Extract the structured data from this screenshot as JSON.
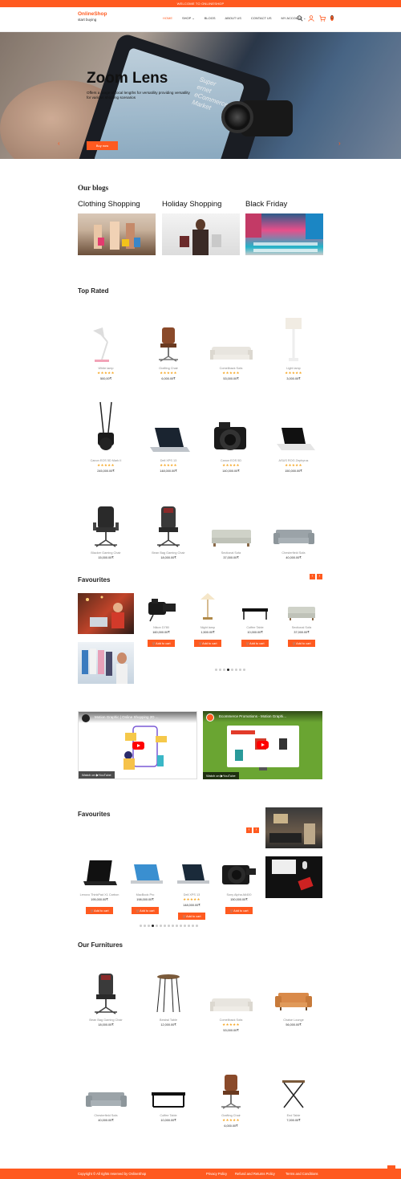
{
  "topbar": {
    "text": "WELCOME TO ONLINESHOP"
  },
  "header": {
    "logo_title": "OnlineShop",
    "logo_sub": "start buying",
    "nav": [
      {
        "label": "HOME",
        "active": true
      },
      {
        "label": "SHOP ⌄",
        "active": false
      },
      {
        "label": "BLOGS",
        "active": false
      },
      {
        "label": "ABOUT US",
        "active": false
      },
      {
        "label": "CONTACT US",
        "active": false
      },
      {
        "label": "MY ACCOUNT ⌄",
        "active": false
      }
    ],
    "cart_count": "0",
    "icons": [
      "search-icon",
      "user-icon",
      "cart-icon"
    ]
  },
  "hero": {
    "title": "Zoom Lens",
    "text": "Offers a range of focal lengths for versatility providing versatility for various shooting scenarios",
    "button": "Buy now",
    "phone_text": "Super\nernet\neCommerce\nMarket"
  },
  "blogs": {
    "heading": "Our blogs",
    "items": [
      {
        "title": "Clothing Shopping"
      },
      {
        "title": "Holiday Shopping"
      },
      {
        "title": "Black Friday"
      }
    ]
  },
  "top_rated": {
    "heading": "Top Rated",
    "products": [
      {
        "name": "White lamp",
        "stars": "★★★★★",
        "price": "500,00₹"
      },
      {
        "name": "Grafting Chair",
        "stars": "★★★★★",
        "price": "6,000.00₹"
      },
      {
        "name": "Comeliback Sofa",
        "stars": "★★★★★",
        "price": "53,000.00₹"
      },
      {
        "name": "Light lamp",
        "stars": "★★★★★",
        "price": "3,000.00₹"
      },
      {
        "name": "Canon EOS 5D Mark II",
        "stars": "★★★★★",
        "price": "245,000.00₹"
      },
      {
        "name": "Dell XPS 13",
        "stars": "★★★★★",
        "price": "148,000.00₹"
      },
      {
        "name": "Canon EOS 5D",
        "stars": "★★★★★",
        "price": "140,000.00₹"
      },
      {
        "name": "ASUS ROG Zephyrus",
        "stars": "★★★★★",
        "price": "150,000.00₹"
      },
      {
        "name": "Blacker Gaming Chair",
        "stars": "",
        "price": "15,000.00₹"
      },
      {
        "name": "Bean Bag Gaming Chair",
        "stars": "",
        "price": "18,000.00₹"
      },
      {
        "name": "Sectional Sofa",
        "stars": "",
        "price": "37,000.00₹"
      },
      {
        "name": "Chesterfield Sofa",
        "stars": "",
        "price": "40,000.00₹"
      }
    ]
  },
  "favourites1": {
    "heading": "Favourites",
    "products": [
      {
        "name": "Nikon D780",
        "price": "160,000.00₹",
        "button": "🛒Add to cart"
      },
      {
        "name": "Night lamp",
        "price": "1,500.00₹",
        "button": "🛒Add to cart"
      },
      {
        "name": "Coffee Table",
        "price": "10,000.00₹",
        "button": "🛒Add to cart"
      },
      {
        "name": "Sectional Sofa",
        "price": "37,000.00₹",
        "button": "🛒Add to cart"
      }
    ]
  },
  "videos": [
    {
      "title": "Motion Graphic | Online Shopping 2D ...",
      "watch": "Watch on ▶YouTube",
      "color": "#ffffff"
    },
    {
      "title": "Ecommerce Promotions - Motion Graphi...",
      "watch": "Watch on ▶YouTube",
      "color": "#6aa532"
    }
  ],
  "favourites2": {
    "heading": "Favourites",
    "products": [
      {
        "name": "Lenovo ThinkPad X1 Carbon",
        "price": "195,000.00₹",
        "stars": "",
        "button": "🛒Add to cart"
      },
      {
        "name": "MacBook Pro",
        "price": "198,000.00₹",
        "stars": "",
        "button": "🛒Add to cart"
      },
      {
        "name": "Dell XPS 13",
        "price": "148,000.00₹",
        "stars": "★★★★★",
        "button": "🛒Add to cart"
      },
      {
        "name": "Sony Alpha A6400",
        "price": "150,000.00₹",
        "stars": "",
        "button": "🛒Add to cart"
      }
    ]
  },
  "furnitures": {
    "heading": "Our Furnitures",
    "products": [
      {
        "name": "Bean Bag Gaming Chair",
        "stars": "",
        "price": "18,000.00₹"
      },
      {
        "name": "Bestral Table",
        "stars": "",
        "price": "12,000.00₹"
      },
      {
        "name": "Comeliback Sofa",
        "stars": "★★★★★",
        "price": "53,000.00₹"
      },
      {
        "name": "Chaise Lounge",
        "stars": "",
        "price": "56,000.00₹"
      },
      {
        "name": "Chesterfield Sofa",
        "stars": "",
        "price": "40,000.00₹"
      },
      {
        "name": "Coffee Table",
        "stars": "",
        "price": "10,000.00₹"
      },
      {
        "name": "Grafting Chair",
        "stars": "★★★★★",
        "price": "6,000.00₹"
      },
      {
        "name": "End Table",
        "stars": "",
        "price": "7,000.00₹"
      }
    ]
  },
  "footer": {
    "copyright": "Copyright © All rights reserved by OnlineShop",
    "links": [
      "Privacy Policy",
      "Refund and Returns Policy",
      "Terms and Conditions"
    ]
  },
  "colors": {
    "accent": "#ff5a1f",
    "star": "#f5a623"
  }
}
